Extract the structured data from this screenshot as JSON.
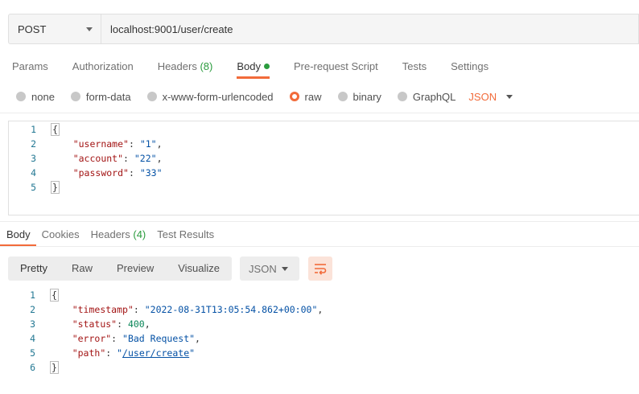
{
  "request": {
    "method": "POST",
    "url": "localhost:9001/user/create"
  },
  "request_tabs": [
    {
      "label": "Params"
    },
    {
      "label": "Authorization"
    },
    {
      "label": "Headers",
      "count": "(8)"
    },
    {
      "label": "Body",
      "active": true
    },
    {
      "label": "Pre-request Script"
    },
    {
      "label": "Tests"
    },
    {
      "label": "Settings"
    }
  ],
  "body_types": {
    "none": "none",
    "form_data": "form-data",
    "urlencoded": "x-www-form-urlencoded",
    "raw": "raw",
    "binary": "binary",
    "graphql": "GraphQL",
    "language": "JSON",
    "selected": "raw"
  },
  "request_body": {
    "line_numbers": [
      "1",
      "2",
      "3",
      "4",
      "5"
    ],
    "open": "{",
    "close": "}",
    "fields": [
      {
        "key": "\"username\"",
        "value": "\"1\"",
        "trail": ","
      },
      {
        "key": "\"account\"",
        "value": "\"22\"",
        "trail": ","
      },
      {
        "key": "\"password\"",
        "value": "\"33\"",
        "trail": ""
      }
    ]
  },
  "response_tabs": {
    "body": "Body",
    "cookies": "Cookies",
    "headers": "Headers",
    "headers_count": "(4)",
    "test_results": "Test Results"
  },
  "response_toolbar": {
    "views": [
      "Pretty",
      "Raw",
      "Preview",
      "Visualize"
    ],
    "format": "JSON"
  },
  "response_body": {
    "line_numbers": [
      "1",
      "2",
      "3",
      "4",
      "5",
      "6"
    ],
    "open": "{",
    "close": "}",
    "timestamp_key": "\"timestamp\"",
    "timestamp_value": "\"2022-08-31T13:05:54.862+00:00\"",
    "status_key": "\"status\"",
    "status_value": "400",
    "error_key": "\"error\"",
    "error_value": "\"Bad Request\"",
    "path_key": "\"path\"",
    "path_value": "/user/create"
  },
  "colors": {
    "accent": "#f26b3a",
    "count_green": "#2b9c3e",
    "json_key": "#a31515",
    "json_string": "#0451a5",
    "json_number": "#098658"
  }
}
